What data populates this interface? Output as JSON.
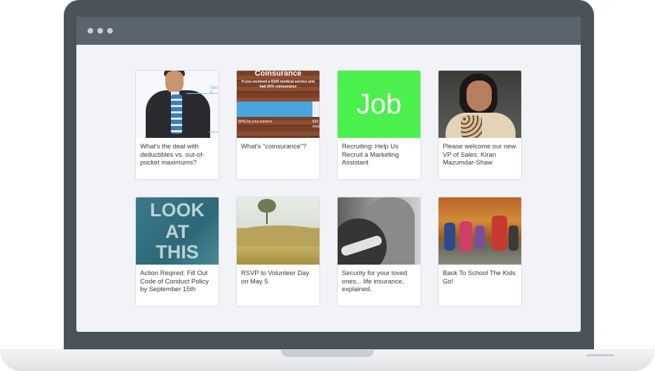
{
  "cards": [
    {
      "caption": "What's the deal with deductibles vs. out-of-pocket maximums?",
      "image": "man-with-stacked-cups-photo",
      "image_text": "Out-o"
    },
    {
      "caption": "What's \"coinsurance\"?",
      "image": "coinsurance-infographic",
      "image_title": "Coinsurance",
      "image_sub": "If you received a $100 medical service and had 20% coinsurance",
      "image_left": "80%) by your surance",
      "image_right": "$20 would"
    },
    {
      "caption": "Recruiting: Help Us Recruit a Marketing Assistant",
      "image": "job-graphic",
      "image_text": "Job"
    },
    {
      "caption": "Please welcome our new VP of Sales: Kiran Mazumdar-Shaw",
      "image": "woman-portrait-photo"
    },
    {
      "caption": "Action Reqired: Fill Out Code of Conduct Policy by September 15th",
      "image": "look-at-this-graphic",
      "image_lines": [
        "LOOK",
        "AT",
        "THIS"
      ]
    },
    {
      "caption": "RSVP to Volunteer Day on May 5",
      "image": "field-landscape-photo"
    },
    {
      "caption": "Security for your loved ones... life insurance, explained.",
      "image": "embrace-photo"
    },
    {
      "caption": "Back To School The Kids Go!",
      "image": "kids-autumn-photo"
    }
  ]
}
